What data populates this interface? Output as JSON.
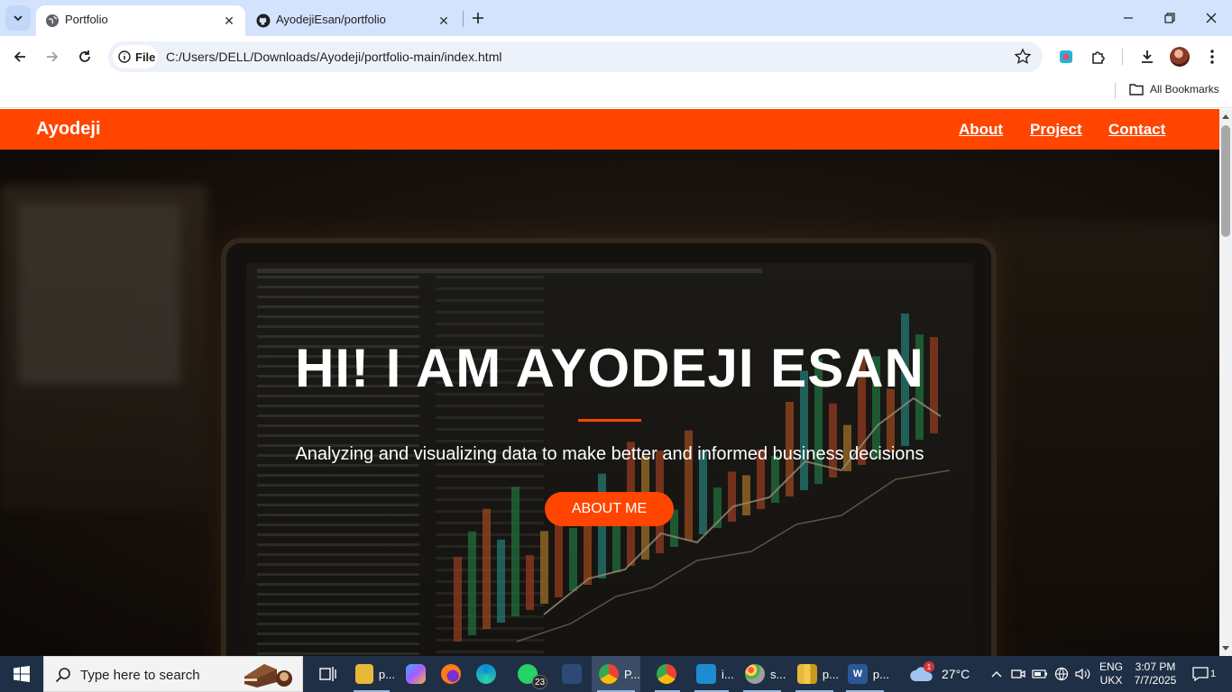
{
  "browser": {
    "tabs": [
      {
        "title": "Portfolio",
        "active": true,
        "icon": "globe-icon"
      },
      {
        "title": "AyodejiEsan/portfolio",
        "active": false,
        "icon": "github-icon"
      }
    ],
    "address": {
      "chip_label": "File",
      "url": "C:/Users/DELL/Downloads/Ayodeji/portfolio-main/index.html"
    },
    "bookmarks": {
      "all_label": "All Bookmarks"
    }
  },
  "site": {
    "brand": "Ayodeji",
    "nav": [
      "About",
      "Project",
      "Contact"
    ],
    "hero": {
      "title": "HI! I AM AYODEJI ESAN",
      "subtitle": "Analyzing and visualizing data to make better and informed business decisions",
      "button": "ABOUT ME"
    },
    "colors": {
      "accent": "#ff4500",
      "text": "#ffffff"
    }
  },
  "taskbar": {
    "search_placeholder": "Type here to search",
    "apps": [
      {
        "name": "file-explorer",
        "label": "p..."
      },
      {
        "name": "copilot",
        "label": ""
      },
      {
        "name": "firefox",
        "label": ""
      },
      {
        "name": "edge",
        "label": ""
      },
      {
        "name": "whatsapp",
        "label": "",
        "badge": "23"
      },
      {
        "name": "tableau",
        "label": ""
      },
      {
        "name": "chrome-portfolio",
        "label": "P..."
      },
      {
        "name": "chrome-alt",
        "label": ""
      },
      {
        "name": "vscode",
        "label": "i..."
      },
      {
        "name": "paint",
        "label": "s..."
      },
      {
        "name": "powerbi",
        "label": "p..."
      },
      {
        "name": "word",
        "label": "p..."
      }
    ],
    "weather": {
      "temp": "27°C",
      "badge": "1"
    },
    "lang": {
      "line1": "ENG",
      "line2": "UKX"
    },
    "clock": {
      "time": "3:07 PM",
      "date": "7/7/2025"
    },
    "notifications": "1"
  }
}
